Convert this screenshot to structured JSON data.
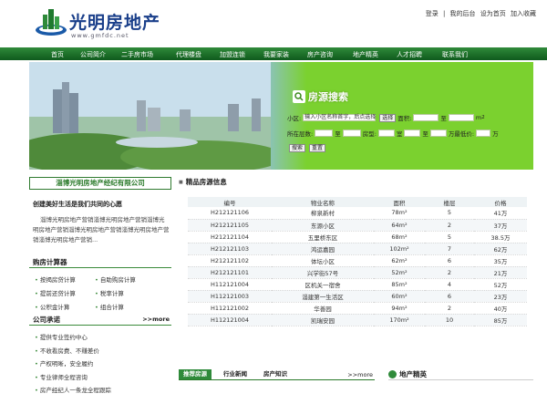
{
  "header": {
    "logo_title": "光明房地产",
    "logo_url": "www.gmfdc.net",
    "links": [
      "登录",
      "|",
      "我的后台",
      "设为首页",
      "加入收藏"
    ]
  },
  "nav": {
    "items": [
      "首页",
      "公司简介",
      "二手房市场",
      "代理楼盘",
      "加盟连锁",
      "我要家装",
      "房产咨询",
      "地产精英",
      "人才招聘",
      "联系我们"
    ]
  },
  "search": {
    "title": "房源搜索",
    "area_label": "小区:",
    "area_placeholder": "输入小区名称首字，后点选择",
    "select_button": "选择",
    "size_label": "面积:",
    "to": "至",
    "unit_m2": "m",
    "floor_label": "所在层数:",
    "rooms_label": "房型:",
    "rooms_unit": "室",
    "price_label": "价格:",
    "price_unit": "万",
    "lowest_label": "最低价:",
    "search_button": "搜索",
    "reset_button": "重置"
  },
  "sidebar": {
    "company_name": "淄博光明房地产经纪有限公司",
    "motto": "创建美好生活是我们共同的心愿",
    "intro": "淄博光明房地产营销淄博光明房地产营销淄博光明房地产营销淄博光明房地产营销淄博光明房地产营销淄博光明房地产营销...",
    "calc_title": "购房计算器",
    "calculators": [
      "按揭房贷计算",
      "自助购房计算",
      "提前还贷计算",
      "税率计算",
      "公积金计算",
      "组合计算"
    ],
    "promise_title": "公司承诺",
    "more": "more",
    "promises": [
      "提供专业签约中心",
      "不收看房费、不赚差价",
      "产权明晰，安全履约",
      "专业律师全程咨询",
      "房产经纪人一条龙全程跟踪"
    ]
  },
  "listings": {
    "title": "精品房源信息",
    "headers": [
      "编号",
      "物业名称",
      "面积",
      "楼层",
      "价格"
    ],
    "rows": [
      [
        "H212121106",
        "柳泉新村",
        "78m²",
        "5",
        "41万"
      ],
      [
        "H212121105",
        "东源小区",
        "64m²",
        "2",
        "37万"
      ],
      [
        "H212121104",
        "五里桥东区",
        "68m²",
        "5",
        "38.5万"
      ],
      [
        "H212121103",
        "鸿运嘉园",
        "102m²",
        "7",
        "62万"
      ],
      [
        "H212121102",
        "体坛小区",
        "62m²",
        "6",
        "35万"
      ],
      [
        "H212121101",
        "兴学街57号",
        "52m²",
        "2",
        "21万"
      ],
      [
        "H112121004",
        "区机关一宿舍",
        "85m²",
        "4",
        "52万"
      ],
      [
        "H112121003",
        "淄建第一生活区",
        "60m²",
        "6",
        "23万"
      ],
      [
        "H112121002",
        "华善园",
        "94m²",
        "2",
        "40万"
      ],
      [
        "H112121004",
        "凯瑞安园",
        "170m²",
        "10",
        "85万"
      ]
    ]
  },
  "bottom": {
    "tabs": [
      "推荐房源",
      "行业新闻",
      "房产知识"
    ],
    "more": "more",
    "news_title": "地产精英"
  }
}
